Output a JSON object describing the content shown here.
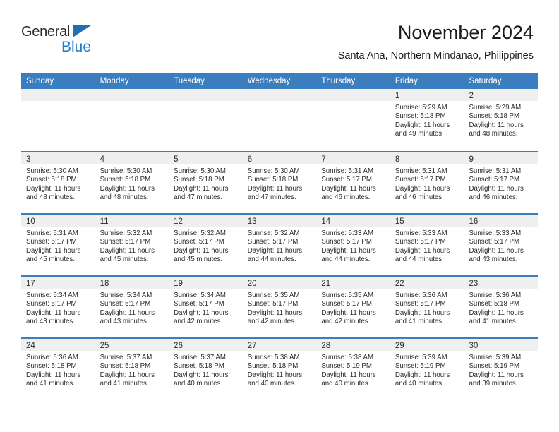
{
  "logo": {
    "word_general": "General",
    "word_blue": "Blue",
    "triangle_color": "#1f6fb5",
    "blue_color": "#1f7fd0"
  },
  "header": {
    "title": "November 2024",
    "subtitle": "Santa Ana, Northern Mindanao, Philippines"
  },
  "theme": {
    "header_blue": "#3a7ebf",
    "day_band_gray": "#efefef",
    "text_dark": "#2b2b2b"
  },
  "weekdays": [
    "Sunday",
    "Monday",
    "Tuesday",
    "Wednesday",
    "Thursday",
    "Friday",
    "Saturday"
  ],
  "weeks": [
    [
      {
        "empty": true
      },
      {
        "empty": true
      },
      {
        "empty": true
      },
      {
        "empty": true
      },
      {
        "empty": true
      },
      {
        "day": "1",
        "sunrise": "Sunrise: 5:29 AM",
        "sunset": "Sunset: 5:18 PM",
        "daylight": "Daylight: 11 hours and 49 minutes."
      },
      {
        "day": "2",
        "sunrise": "Sunrise: 5:29 AM",
        "sunset": "Sunset: 5:18 PM",
        "daylight": "Daylight: 11 hours and 48 minutes."
      }
    ],
    [
      {
        "day": "3",
        "sunrise": "Sunrise: 5:30 AM",
        "sunset": "Sunset: 5:18 PM",
        "daylight": "Daylight: 11 hours and 48 minutes."
      },
      {
        "day": "4",
        "sunrise": "Sunrise: 5:30 AM",
        "sunset": "Sunset: 5:18 PM",
        "daylight": "Daylight: 11 hours and 48 minutes."
      },
      {
        "day": "5",
        "sunrise": "Sunrise: 5:30 AM",
        "sunset": "Sunset: 5:18 PM",
        "daylight": "Daylight: 11 hours and 47 minutes."
      },
      {
        "day": "6",
        "sunrise": "Sunrise: 5:30 AM",
        "sunset": "Sunset: 5:18 PM",
        "daylight": "Daylight: 11 hours and 47 minutes."
      },
      {
        "day": "7",
        "sunrise": "Sunrise: 5:31 AM",
        "sunset": "Sunset: 5:17 PM",
        "daylight": "Daylight: 11 hours and 46 minutes."
      },
      {
        "day": "8",
        "sunrise": "Sunrise: 5:31 AM",
        "sunset": "Sunset: 5:17 PM",
        "daylight": "Daylight: 11 hours and 46 minutes."
      },
      {
        "day": "9",
        "sunrise": "Sunrise: 5:31 AM",
        "sunset": "Sunset: 5:17 PM",
        "daylight": "Daylight: 11 hours and 46 minutes."
      }
    ],
    [
      {
        "day": "10",
        "sunrise": "Sunrise: 5:31 AM",
        "sunset": "Sunset: 5:17 PM",
        "daylight": "Daylight: 11 hours and 45 minutes."
      },
      {
        "day": "11",
        "sunrise": "Sunrise: 5:32 AM",
        "sunset": "Sunset: 5:17 PM",
        "daylight": "Daylight: 11 hours and 45 minutes."
      },
      {
        "day": "12",
        "sunrise": "Sunrise: 5:32 AM",
        "sunset": "Sunset: 5:17 PM",
        "daylight": "Daylight: 11 hours and 45 minutes."
      },
      {
        "day": "13",
        "sunrise": "Sunrise: 5:32 AM",
        "sunset": "Sunset: 5:17 PM",
        "daylight": "Daylight: 11 hours and 44 minutes."
      },
      {
        "day": "14",
        "sunrise": "Sunrise: 5:33 AM",
        "sunset": "Sunset: 5:17 PM",
        "daylight": "Daylight: 11 hours and 44 minutes."
      },
      {
        "day": "15",
        "sunrise": "Sunrise: 5:33 AM",
        "sunset": "Sunset: 5:17 PM",
        "daylight": "Daylight: 11 hours and 44 minutes."
      },
      {
        "day": "16",
        "sunrise": "Sunrise: 5:33 AM",
        "sunset": "Sunset: 5:17 PM",
        "daylight": "Daylight: 11 hours and 43 minutes."
      }
    ],
    [
      {
        "day": "17",
        "sunrise": "Sunrise: 5:34 AM",
        "sunset": "Sunset: 5:17 PM",
        "daylight": "Daylight: 11 hours and 43 minutes."
      },
      {
        "day": "18",
        "sunrise": "Sunrise: 5:34 AM",
        "sunset": "Sunset: 5:17 PM",
        "daylight": "Daylight: 11 hours and 43 minutes."
      },
      {
        "day": "19",
        "sunrise": "Sunrise: 5:34 AM",
        "sunset": "Sunset: 5:17 PM",
        "daylight": "Daylight: 11 hours and 42 minutes."
      },
      {
        "day": "20",
        "sunrise": "Sunrise: 5:35 AM",
        "sunset": "Sunset: 5:17 PM",
        "daylight": "Daylight: 11 hours and 42 minutes."
      },
      {
        "day": "21",
        "sunrise": "Sunrise: 5:35 AM",
        "sunset": "Sunset: 5:17 PM",
        "daylight": "Daylight: 11 hours and 42 minutes."
      },
      {
        "day": "22",
        "sunrise": "Sunrise: 5:36 AM",
        "sunset": "Sunset: 5:17 PM",
        "daylight": "Daylight: 11 hours and 41 minutes."
      },
      {
        "day": "23",
        "sunrise": "Sunrise: 5:36 AM",
        "sunset": "Sunset: 5:18 PM",
        "daylight": "Daylight: 11 hours and 41 minutes."
      }
    ],
    [
      {
        "day": "24",
        "sunrise": "Sunrise: 5:36 AM",
        "sunset": "Sunset: 5:18 PM",
        "daylight": "Daylight: 11 hours and 41 minutes."
      },
      {
        "day": "25",
        "sunrise": "Sunrise: 5:37 AM",
        "sunset": "Sunset: 5:18 PM",
        "daylight": "Daylight: 11 hours and 41 minutes."
      },
      {
        "day": "26",
        "sunrise": "Sunrise: 5:37 AM",
        "sunset": "Sunset: 5:18 PM",
        "daylight": "Daylight: 11 hours and 40 minutes."
      },
      {
        "day": "27",
        "sunrise": "Sunrise: 5:38 AM",
        "sunset": "Sunset: 5:18 PM",
        "daylight": "Daylight: 11 hours and 40 minutes."
      },
      {
        "day": "28",
        "sunrise": "Sunrise: 5:38 AM",
        "sunset": "Sunset: 5:19 PM",
        "daylight": "Daylight: 11 hours and 40 minutes."
      },
      {
        "day": "29",
        "sunrise": "Sunrise: 5:39 AM",
        "sunset": "Sunset: 5:19 PM",
        "daylight": "Daylight: 11 hours and 40 minutes."
      },
      {
        "day": "30",
        "sunrise": "Sunrise: 5:39 AM",
        "sunset": "Sunset: 5:19 PM",
        "daylight": "Daylight: 11 hours and 39 minutes."
      }
    ]
  ]
}
